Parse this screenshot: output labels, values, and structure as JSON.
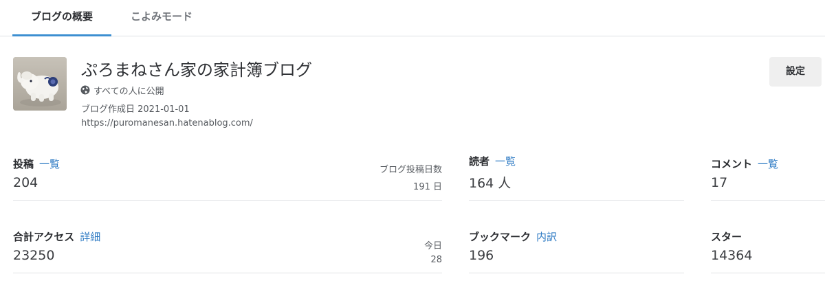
{
  "tabs": [
    {
      "label": "ブログの概要"
    },
    {
      "label": "こよみモード"
    }
  ],
  "blog": {
    "title": "ぷろまねさん家の家計簿ブログ",
    "visibility": "すべての人に公開",
    "created": "ブログ作成日 2021-01-01",
    "url": "https://puromanesan.hatenablog.com/",
    "settings_label": "設定"
  },
  "stats": {
    "posts": {
      "label": "投稿",
      "link": "一覧",
      "value": "204",
      "sub_label": "ブログ投稿日数",
      "sub_value": "191 日"
    },
    "readers": {
      "label": "読者",
      "link": "一覧",
      "value": "164 人"
    },
    "comments": {
      "label": "コメント",
      "link": "一覧",
      "value": "17"
    },
    "access": {
      "label": "合計アクセス",
      "link": "詳細",
      "value": "23250",
      "sub_label": "今日",
      "sub_value": "28"
    },
    "bookmark": {
      "label": "ブックマーク",
      "link": "内訳",
      "value": "196"
    },
    "star": {
      "label": "スター",
      "value": "14364"
    }
  },
  "colors": {
    "accent": "#3d8fd1",
    "link": "#2f7bc4"
  },
  "icons": {
    "visibility": "globe-icon"
  }
}
